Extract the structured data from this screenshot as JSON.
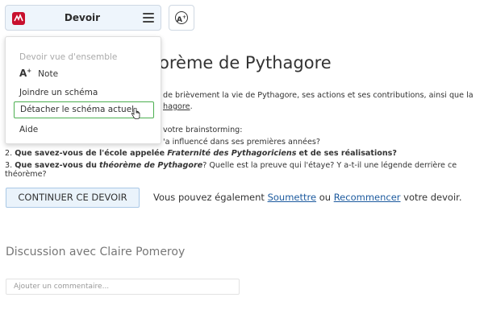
{
  "toolbar": {
    "title": "Devoir",
    "font_button_label": "A"
  },
  "menu": {
    "header": "Devoir vue d'ensemble",
    "items": [
      {
        "label": "Note"
      },
      {
        "label": "Joindre un schéma"
      },
      {
        "label": "Détacher le schéma actuel"
      },
      {
        "label": "Aide"
      }
    ]
  },
  "content": {
    "title_visible": "orème de Pythagore",
    "intro_line1": "de brièvement la vie de Pythagore, ses actions et ses contributions, ainsi que la",
    "intro_line2": "hagore",
    "intro_line2_end": ".",
    "q_intro": "votre brainstorming:",
    "q1_cont": "'a influencé dans ses premières années?",
    "q2_num": "2.",
    "q2_bold": "Que savez-vous de l'école appelée",
    "q2_italic": "Fraternité des Pythagoriciens",
    "q2_bold2": "et de ses réalisations?",
    "q3_num": "3.",
    "q3_bold": "Que savez-vous du",
    "q3_italic": "théorème de Pythagore",
    "q3_rest": "? Quelle est la preuve qui l'étaye? Y a-t-il une légende derrière ce théorème?"
  },
  "actions": {
    "continue_label": "CONTINUER CE DEVOIR",
    "also_prefix": "Vous pouvez également",
    "submit_link": "Soumettre",
    "or_text": "ou",
    "restart_link": "Recommencer",
    "also_suffix": "votre devoir."
  },
  "discussion": {
    "title": "Discussion avec Claire Pomeroy",
    "comment_placeholder": "Ajouter un commentaire..."
  },
  "colors": {
    "brand": "#c8102e",
    "highlight_border": "#4caf50",
    "link": "#1c5a9e"
  }
}
